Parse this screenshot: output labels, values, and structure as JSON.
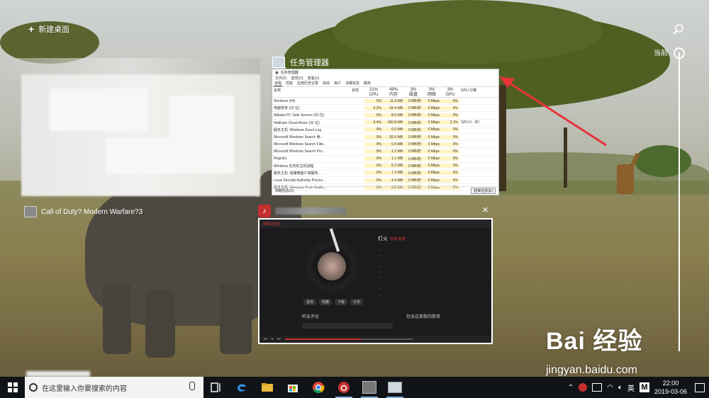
{
  "task_view": {
    "new_desktop_label": "新建桌面",
    "timeline_label": "当前",
    "windows": [
      {
        "title": "Call of Duty? Modern Warfare?3"
      },
      {
        "title": "任务管理器",
        "tabs": [
          "进程",
          "性能",
          "应用历史记录",
          "启动",
          "用户",
          "详细信息",
          "服务"
        ],
        "menus": [
          "文件(F)",
          "选项(O)",
          "查看(V)"
        ],
        "columns": {
          "name": "名称",
          "status": "状态",
          "cpu_pct": "21%",
          "cpu": "CPU",
          "mem_pct": "49%",
          "mem": "内存",
          "disk_pct": "3%",
          "disk": "磁盘",
          "net_pct": "0%",
          "net": "网络",
          "gpu_pct": "3%",
          "gpu": "GPU",
          "gpu_engine": "GPU 引擎"
        },
        "rows": [
          {
            "name": "Windows (64)",
            "cpu": "0%",
            "mem": "11.9 MB",
            "disk": "0 MB/秒",
            "net": "0 Mbps",
            "gpu": "0%",
            "engine": ""
          },
          {
            "name": "电脑管家 (32 位)",
            "cpu": "0.2%",
            "mem": "34.4 MB",
            "disk": "0 MB/秒",
            "net": "0 Mbps",
            "gpu": "0%",
            "engine": ""
          },
          {
            "name": "Alibaba PC Safe Service (32 位)",
            "cpu": "0%",
            "mem": "8.6 MB",
            "disk": "0 MB/秒",
            "net": "0 Mbps",
            "gpu": "0%",
            "engine": ""
          },
          {
            "name": "NetEase Cloud Music (32 位)",
            "cpu": "8.4%",
            "mem": "160.8 MB",
            "disk": "0 MB/秒",
            "net": "0 Mbps",
            "gpu": "2.1%",
            "engine": "GPU 0 - 3D"
          },
          {
            "name": "服务主机: Windows Event Log",
            "cpu": "0%",
            "mem": "6.0 MB",
            "disk": "0 MB/秒",
            "net": "0 Mbps",
            "gpu": "0%",
            "engine": ""
          },
          {
            "name": "Microsoft Windows Search 索...",
            "cpu": "0%",
            "mem": "92.0 MB",
            "disk": "0 MB/秒",
            "net": "0 Mbps",
            "gpu": "0%",
            "engine": ""
          },
          {
            "name": "Microsoft Windows Search Filte...",
            "cpu": "0%",
            "mem": "0.9 MB",
            "disk": "0 MB/秒",
            "net": "0 Mbps",
            "gpu": "0%",
            "engine": ""
          },
          {
            "name": "Microsoft Windows Search Pro...",
            "cpu": "0%",
            "mem": "1.2 MB",
            "disk": "0 MB/秒",
            "net": "0 Mbps",
            "gpu": "0%",
            "engine": ""
          },
          {
            "name": "Registry",
            "cpu": "0%",
            "mem": "1.1 MB",
            "disk": "0 MB/秒",
            "net": "0 Mbps",
            "gpu": "0%",
            "engine": ""
          },
          {
            "name": "Windows 任务的主机进程",
            "cpu": "0%",
            "mem": "5.2 MB",
            "disk": "0 MB/秒",
            "net": "0 Mbps",
            "gpu": "0%",
            "engine": ""
          },
          {
            "name": "服务主机: 组策略客户端服务...",
            "cpu": "0%",
            "mem": "7.2 MB",
            "disk": "0 MB/秒",
            "net": "0 Mbps",
            "gpu": "0%",
            "engine": ""
          },
          {
            "name": "Local Security Authority Proces...",
            "cpu": "0%",
            "mem": "4.9 MB",
            "disk": "0 MB/秒",
            "net": "0 Mbps",
            "gpu": "0%",
            "engine": ""
          },
          {
            "name": "服务主机: Windows Push Notific...",
            "cpu": "0%",
            "mem": "6.2 MB",
            "disk": "0 MB/秒",
            "net": "0 Mbps",
            "gpu": "0%",
            "engine": ""
          }
        ],
        "footer_left": "简略信息(D)",
        "footer_button": "结束任务(E)"
      },
      {
        "app_icon_char": "♪",
        "close_glyph": "×",
        "app_name": "网易云音乐",
        "song_title": "灯火",
        "song_sub": "标准 音质",
        "lyrics": [
          "...",
          "...",
          "...",
          "...",
          "...",
          "...",
          "...",
          "...",
          "...",
          "..."
        ],
        "buttons": [
          "喜欢",
          "收藏",
          "下载",
          "分享"
        ],
        "comments_label": "听友评论",
        "similar_label": "包含这首歌的歌单",
        "similar_items": [
          "...",
          "..."
        ]
      }
    ]
  },
  "watermark": {
    "text": "Bai 经验",
    "url": "jingyan.baidu.com"
  },
  "taskbar": {
    "search_placeholder": "在这里输入你要搜索的内容",
    "input_lang": "英",
    "ime_badge": "M",
    "time": "22:00",
    "date": "2019-03-06",
    "pinned": [
      {
        "name": "task-view",
        "icon": "task-view-icon"
      },
      {
        "name": "edge",
        "icon": "edge-icon"
      },
      {
        "name": "file-explorer",
        "icon": "folder-icon"
      },
      {
        "name": "store",
        "icon": "store-icon"
      },
      {
        "name": "chrome",
        "icon": "chrome-icon"
      },
      {
        "name": "netease-music",
        "icon": "netease-music-icon"
      },
      {
        "name": "game",
        "icon": "game-icon"
      },
      {
        "name": "task-manager",
        "icon": "task-manager-icon"
      }
    ]
  },
  "colors": {
    "taskbar_bg": "#101418",
    "netease_red": "#c62f2f",
    "arrow_red": "#e8333a",
    "tm_highlight": "#fff4c4"
  }
}
